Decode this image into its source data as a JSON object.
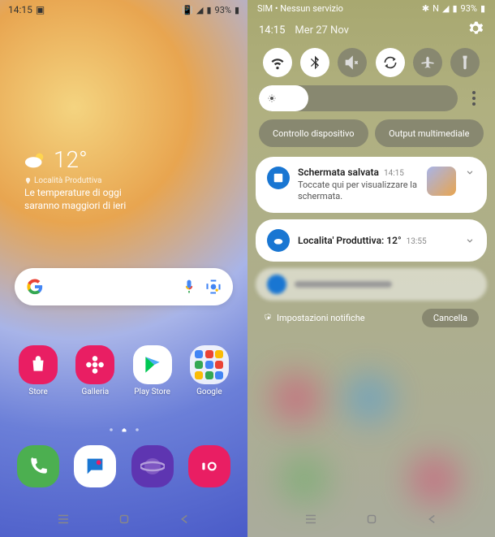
{
  "statusbar": {
    "time": "14:15",
    "battery": "93%"
  },
  "left": {
    "weather": {
      "temp": "12°",
      "location": "Località Produttiva",
      "desc": "Le temperature di oggi saranno maggiori di ieri"
    },
    "apps": {
      "store": "Store",
      "galleria": "Galleria",
      "playstore": "Play Store",
      "google": "Google"
    }
  },
  "right": {
    "sim": "SIM • Nessun servizio",
    "battery": "93%",
    "time": "14:15",
    "date": "Mer 27 Nov",
    "controls": {
      "device": "Controllo dispositivo",
      "media": "Output multimediale"
    },
    "notif1": {
      "title": "Schermata salvata",
      "time": "14:15",
      "text": "Toccate qui per visualizzare la schermata."
    },
    "notif2": {
      "title": "Localita' Produttiva: 12°",
      "time": "13:55"
    },
    "footer": {
      "settings": "Impostazioni notifiche",
      "clear": "Cancella"
    }
  }
}
